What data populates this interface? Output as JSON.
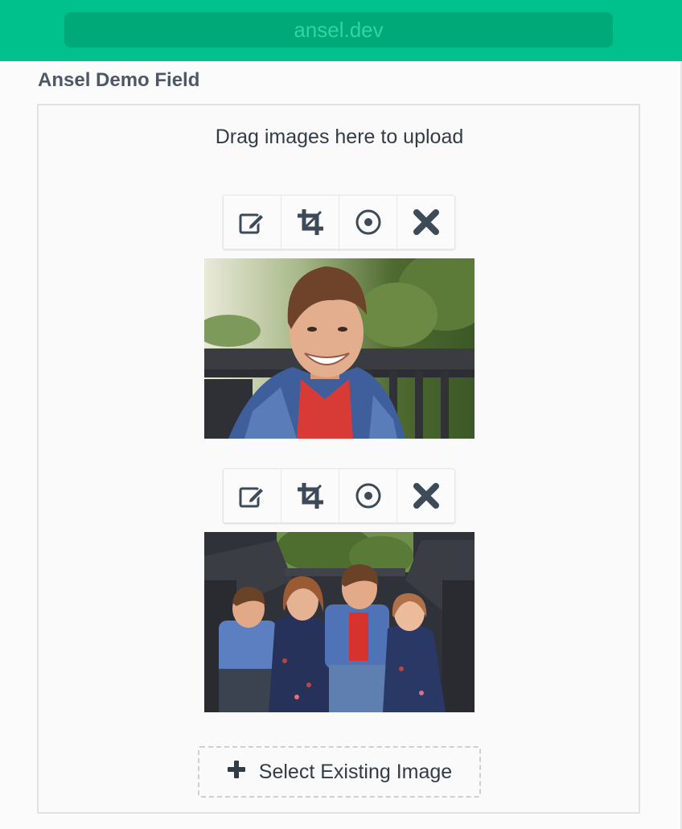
{
  "browser": {
    "url": "ansel.dev"
  },
  "field": {
    "label": "Ansel Demo Field",
    "drop_hint": "Drag images here to upload",
    "select_existing_label": "Select Existing Image"
  },
  "images": [
    {
      "tools": [
        "edit-icon",
        "crop-icon",
        "focal-point-icon",
        "remove-icon"
      ],
      "subject": "boy-portrait"
    },
    {
      "tools": [
        "edit-icon",
        "crop-icon",
        "focal-point-icon",
        "remove-icon"
      ],
      "subject": "four-children-on-steps"
    }
  ],
  "colors": {
    "accent": "#00c08b",
    "accent_dark": "#00a978",
    "icon": "#3d4a58"
  }
}
